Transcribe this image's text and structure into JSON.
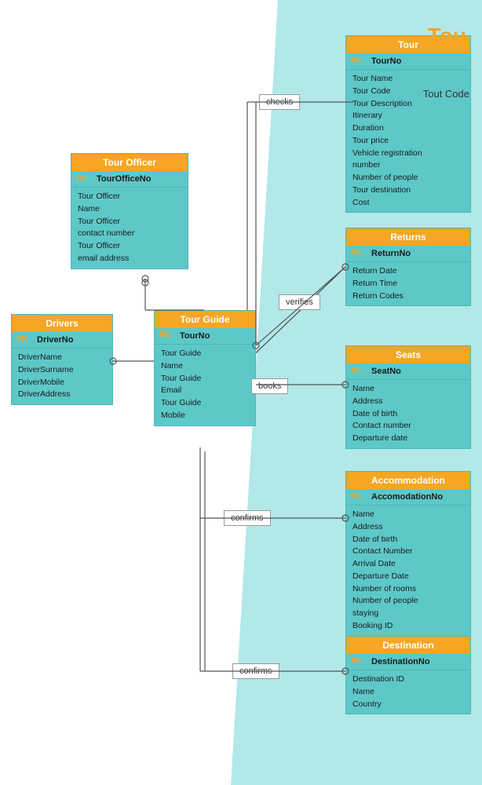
{
  "title": "Tou",
  "subtitle": "Tout Code",
  "entities": {
    "tour": {
      "header": "Tour",
      "pk_label": "PK",
      "pk_value": "TourNo",
      "attrs": [
        "Tour Name",
        "Tour Code",
        "Tour Description",
        "Itinerary",
        "Duration",
        "Tour price",
        "Vehicle registration",
        "number",
        "Number of people",
        "Tour destination",
        "Cost"
      ]
    },
    "returns": {
      "header": "Returns",
      "pk_label": "PK",
      "pk_value": "ReturnNo",
      "attrs": [
        "Return Date",
        "Return Time",
        "Return Codes"
      ]
    },
    "seats": {
      "header": "Seats",
      "pk_label": "PK",
      "pk_value": "SeatNo",
      "attrs": [
        "Name",
        "Address",
        "Date of birth",
        "Contact number",
        "Departure date"
      ]
    },
    "accommodation": {
      "header": "Accommodation",
      "pk_label": "PK",
      "pk_value": "AccomodationNo",
      "attrs": [
        "Name",
        "Address",
        "Date of birth",
        "Contact Number",
        "Arrival Date",
        "Departure Date",
        "Number of rooms",
        "Number of people",
        "staying",
        "Booking ID"
      ]
    },
    "destination": {
      "header": "Destination",
      "pk_label": "PK",
      "pk_value": "DestinationNo",
      "attrs": [
        "Destination ID",
        "Name",
        "Country"
      ]
    },
    "tour_officer": {
      "header": "Tour Officer",
      "pk_label": "PK",
      "pk_value": "TourOfficeNo",
      "attrs": [
        "Tour Officer",
        "Name",
        "Tour Officer",
        "contact number",
        "Tour Officer",
        "email address"
      ]
    },
    "drivers": {
      "header": "Drivers",
      "pk_label": "PK",
      "pk_value": "DriverNo",
      "attrs": [
        "DriverName",
        "DriverSurname",
        "DriverMobile",
        "DriverAddress"
      ]
    },
    "tour_guide": {
      "header": "Tour Guide",
      "pk_label": "PK",
      "pk_value": "TourNo",
      "attrs": [
        "Tour Guide",
        "Name",
        "Tour Guide",
        "Email",
        "Tour Guide",
        "Mobile"
      ]
    }
  },
  "relations": {
    "checks": "checks",
    "verifies": "verifies",
    "books": "books",
    "confirms1": "confirms",
    "confirms2": "confirms"
  }
}
